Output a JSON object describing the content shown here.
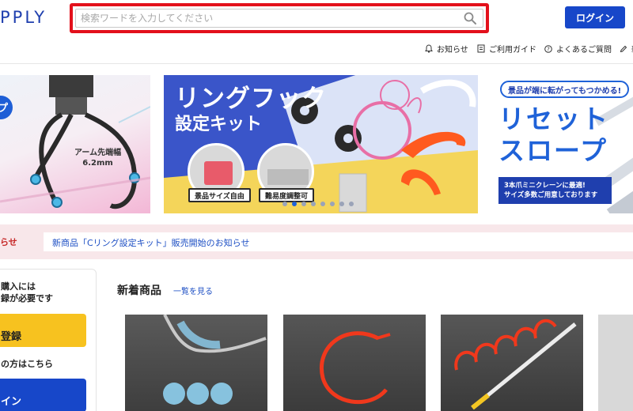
{
  "header": {
    "logo_text": "PPLY",
    "search": {
      "placeholder": "検索ワードを入力してください",
      "value": ""
    },
    "login_label": "ログイン",
    "subnav": [
      {
        "label": "お知らせ",
        "icon": "bell-icon"
      },
      {
        "label": "ご利用ガイド",
        "icon": "guide-book-icon"
      },
      {
        "label": "よくあるご質問",
        "icon": "question-circle-icon"
      },
      {
        "label": "新",
        "icon": "pencil-icon"
      }
    ]
  },
  "banners": {
    "left": {
      "badge": "プ",
      "caption_line1": "アーム先端幅",
      "caption_line2": "6.2mm"
    },
    "middle": {
      "title": "リングフック",
      "subtitle": "設定キット",
      "tags": [
        "景品サイズ自由",
        "難易度調整可"
      ]
    },
    "right": {
      "pill": "景品が端に転がってもつかめる!",
      "title_line1": "リセット",
      "title_line2": "スロープ",
      "note_line1": "3本爪ミニクレーンに最適!",
      "note_line2": "サイズ多数ご用意しております"
    },
    "carousel": {
      "count": 8,
      "active_index": 1
    }
  },
  "news": {
    "label": "らせ",
    "items": [
      {
        "text": "新商品「Cリング設定キット」販売開始のお知らせ"
      }
    ]
  },
  "sidebar": {
    "line1": "購入には",
    "line2": "録が必要です",
    "register_button": "登録",
    "member_text": "の方はこちら",
    "login_button": "イン"
  },
  "new_products": {
    "title": "新着商品",
    "view_all": "一覧を見る"
  },
  "colors": {
    "brand_blue": "#1747c9",
    "search_highlight": "#e3101b",
    "cta_yellow": "#f7c21f",
    "news_bg": "#f8e7ea"
  }
}
